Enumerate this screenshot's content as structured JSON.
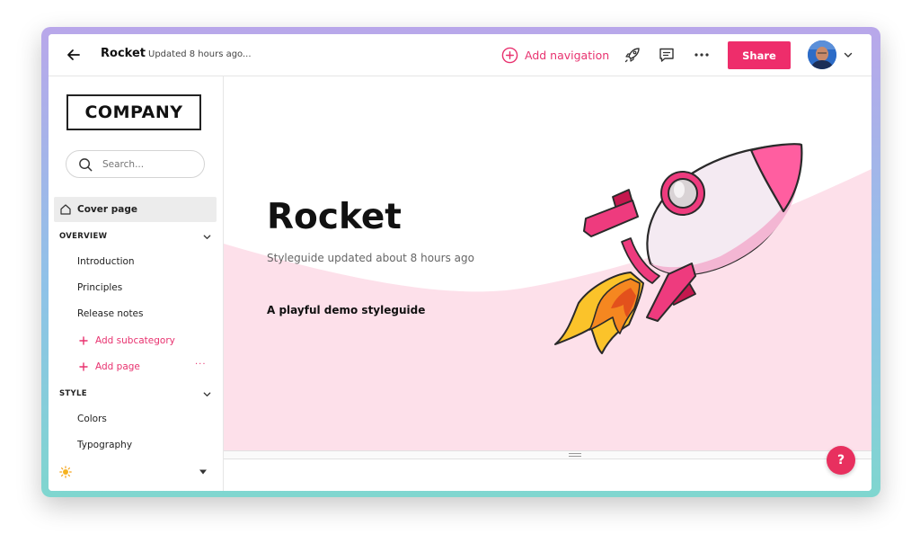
{
  "topbar": {
    "doc_title": "Rocket",
    "updated_text": "Updated 8 hours ago...",
    "add_navigation_label": "Add navigation",
    "share_label": "Share"
  },
  "sidebar": {
    "logo_text": "COMPANY",
    "search_placeholder": "Search...",
    "cover_page_label": "Cover page",
    "sections": [
      {
        "label": "OVERVIEW",
        "items": [
          "Introduction",
          "Principles",
          "Release notes"
        ],
        "add_subcategory_label": "Add subcategory",
        "add_page_label": "Add page",
        "more_label": "···"
      },
      {
        "label": "STYLE",
        "items": [
          "Colors",
          "Typography"
        ]
      }
    ],
    "theme_icon": "sun-icon"
  },
  "main": {
    "hero_title": "Rocket",
    "hero_subtitle": "Styleguide updated about 8 hours ago",
    "hero_tagline": "A playful demo styleguide"
  },
  "help_label": "?",
  "colors": {
    "accent": "#ee2d6b",
    "hero_pink": "#fde0ea",
    "frame_gradient_top": "#b9a7ea",
    "frame_gradient_bottom": "#7fd6cf"
  }
}
